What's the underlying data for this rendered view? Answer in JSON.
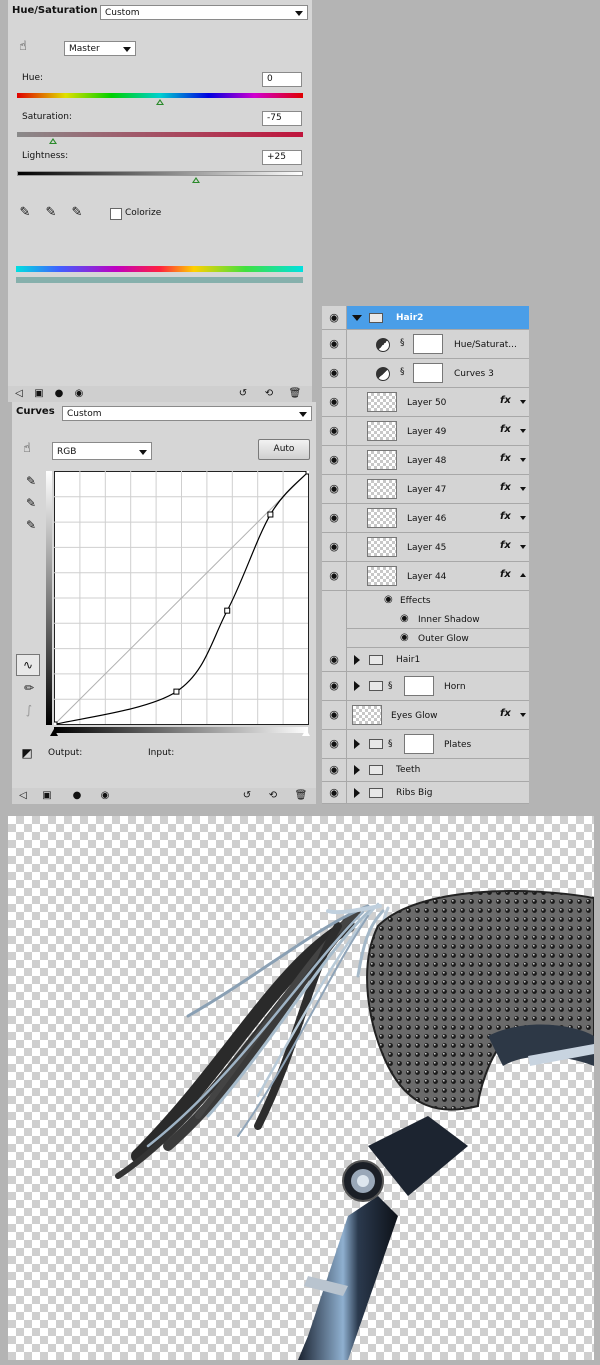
{
  "hue_saturation": {
    "title": "Hue/Saturation",
    "preset": "Custom",
    "channel": "Master",
    "hue_label": "Hue:",
    "hue_value": "0",
    "saturation_label": "Saturation:",
    "saturation_value": "-75",
    "lightness_label": "Lightness:",
    "lightness_value": "+25",
    "colorize_label": "Colorize",
    "colorize_checked": false,
    "hue_slider_fraction": 0.5,
    "saturation_slider_fraction": 0.125,
    "lightness_slider_fraction": 0.625
  },
  "curves": {
    "title": "Curves",
    "preset": "Custom",
    "channel": "RGB",
    "auto_label": "Auto",
    "output_label": "Output:",
    "input_label": "Input:",
    "curve_points": [
      [
        0,
        0
      ],
      [
        48,
        13
      ],
      [
        68,
        45
      ],
      [
        85,
        83
      ],
      [
        100,
        100
      ]
    ]
  },
  "layers": {
    "group": "Hair2",
    "items": [
      {
        "name": "Hue/Saturat...",
        "kind": "adjustment"
      },
      {
        "name": "Curves 3",
        "kind": "adjustment"
      },
      {
        "name": "Layer 50",
        "kind": "layer",
        "fx": true
      },
      {
        "name": "Layer 49",
        "kind": "layer",
        "fx": true
      },
      {
        "name": "Layer 48",
        "kind": "layer",
        "fx": true
      },
      {
        "name": "Layer 47",
        "kind": "layer",
        "fx": true
      },
      {
        "name": "Layer 46",
        "kind": "layer",
        "fx": true
      },
      {
        "name": "Layer 45",
        "kind": "layer",
        "fx": true
      },
      {
        "name": "Layer 44",
        "kind": "layer",
        "fx": true
      }
    ],
    "effects_label": "Effects",
    "effects": [
      "Inner Shadow",
      "Outer Glow"
    ],
    "others": [
      {
        "name": "Hair1",
        "kind": "group"
      },
      {
        "name": "Horn",
        "kind": "group-masked"
      },
      {
        "name": "Eyes Glow",
        "kind": "layer",
        "fx": true
      },
      {
        "name": "Plates",
        "kind": "group-masked"
      },
      {
        "name": "Teeth",
        "kind": "group"
      },
      {
        "name": "Ribs Big",
        "kind": "group"
      }
    ],
    "fx_label": "fx"
  },
  "colors": {
    "selection": "#4a9ee8",
    "panel": "#d6d6d6",
    "thumb": "#2a8a2a"
  }
}
